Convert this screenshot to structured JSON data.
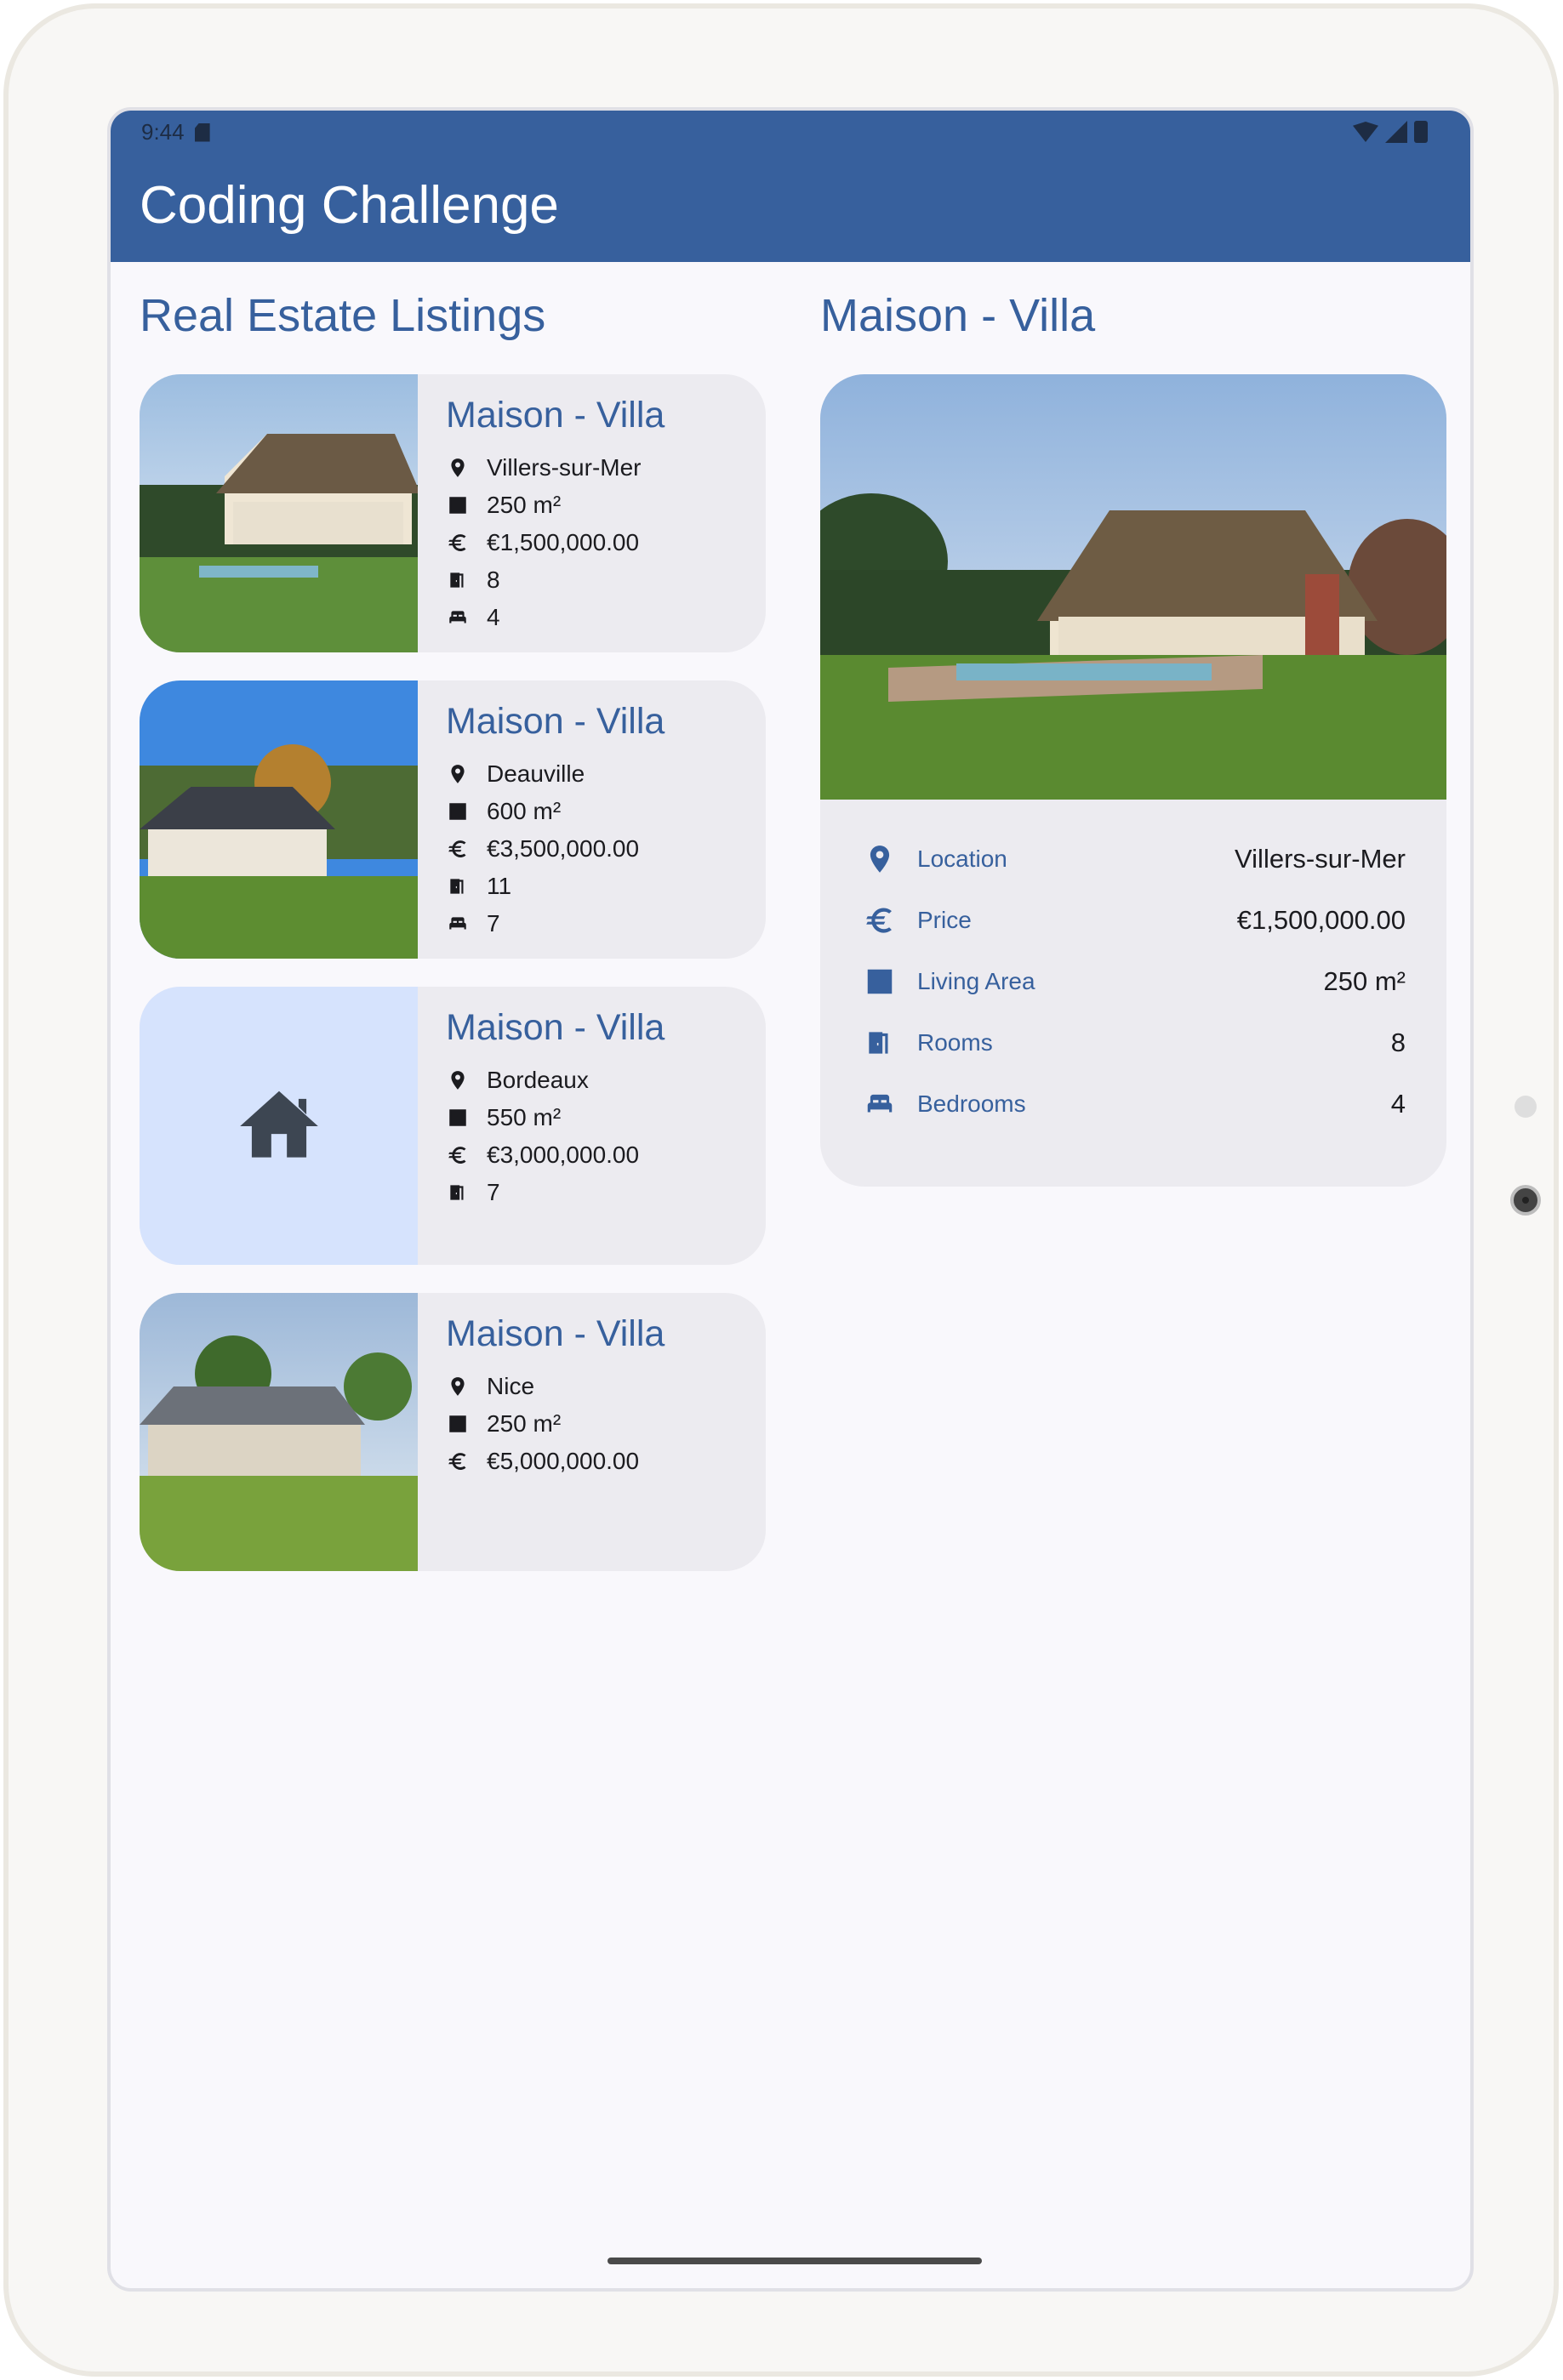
{
  "status_bar": {
    "time": "9:44"
  },
  "app": {
    "title": "Coding Challenge"
  },
  "listings_section": {
    "title": "Real Estate Listings"
  },
  "listings": [
    {
      "title": "Maison - Villa",
      "city": "Villers-sur-Mer",
      "area": "250 m²",
      "price": "€1,500,000.00",
      "rooms": "8",
      "bedrooms": "4",
      "image": "photo"
    },
    {
      "title": "Maison - Villa",
      "city": "Deauville",
      "area": "600 m²",
      "price": "€3,500,000.00",
      "rooms": "11",
      "bedrooms": "7",
      "image": "photo"
    },
    {
      "title": "Maison - Villa",
      "city": "Bordeaux",
      "area": "550 m²",
      "price": "€3,000,000.00",
      "rooms": "7",
      "image": "house-placeholder-icon"
    },
    {
      "title": "Maison - Villa",
      "city": "Nice",
      "area": "250 m²",
      "price": "€5,000,000.00",
      "image": "photo"
    }
  ],
  "detail": {
    "title": "Maison - Villa",
    "rows": [
      {
        "label": "Location",
        "value": "Villers-sur-Mer",
        "icon": "location-icon"
      },
      {
        "label": "Price",
        "value": "€1,500,000.00",
        "icon": "euro-icon"
      },
      {
        "label": "Living Area",
        "value": "250 m²",
        "icon": "area-icon"
      },
      {
        "label": "Rooms",
        "value": "8",
        "icon": "door-icon"
      },
      {
        "label": "Bedrooms",
        "value": "4",
        "icon": "bed-icon"
      }
    ]
  },
  "colors": {
    "primary": "#37609d",
    "card": "#ecebf0",
    "placeholder": "#d6e3fd",
    "text": "#1b1b1f"
  }
}
